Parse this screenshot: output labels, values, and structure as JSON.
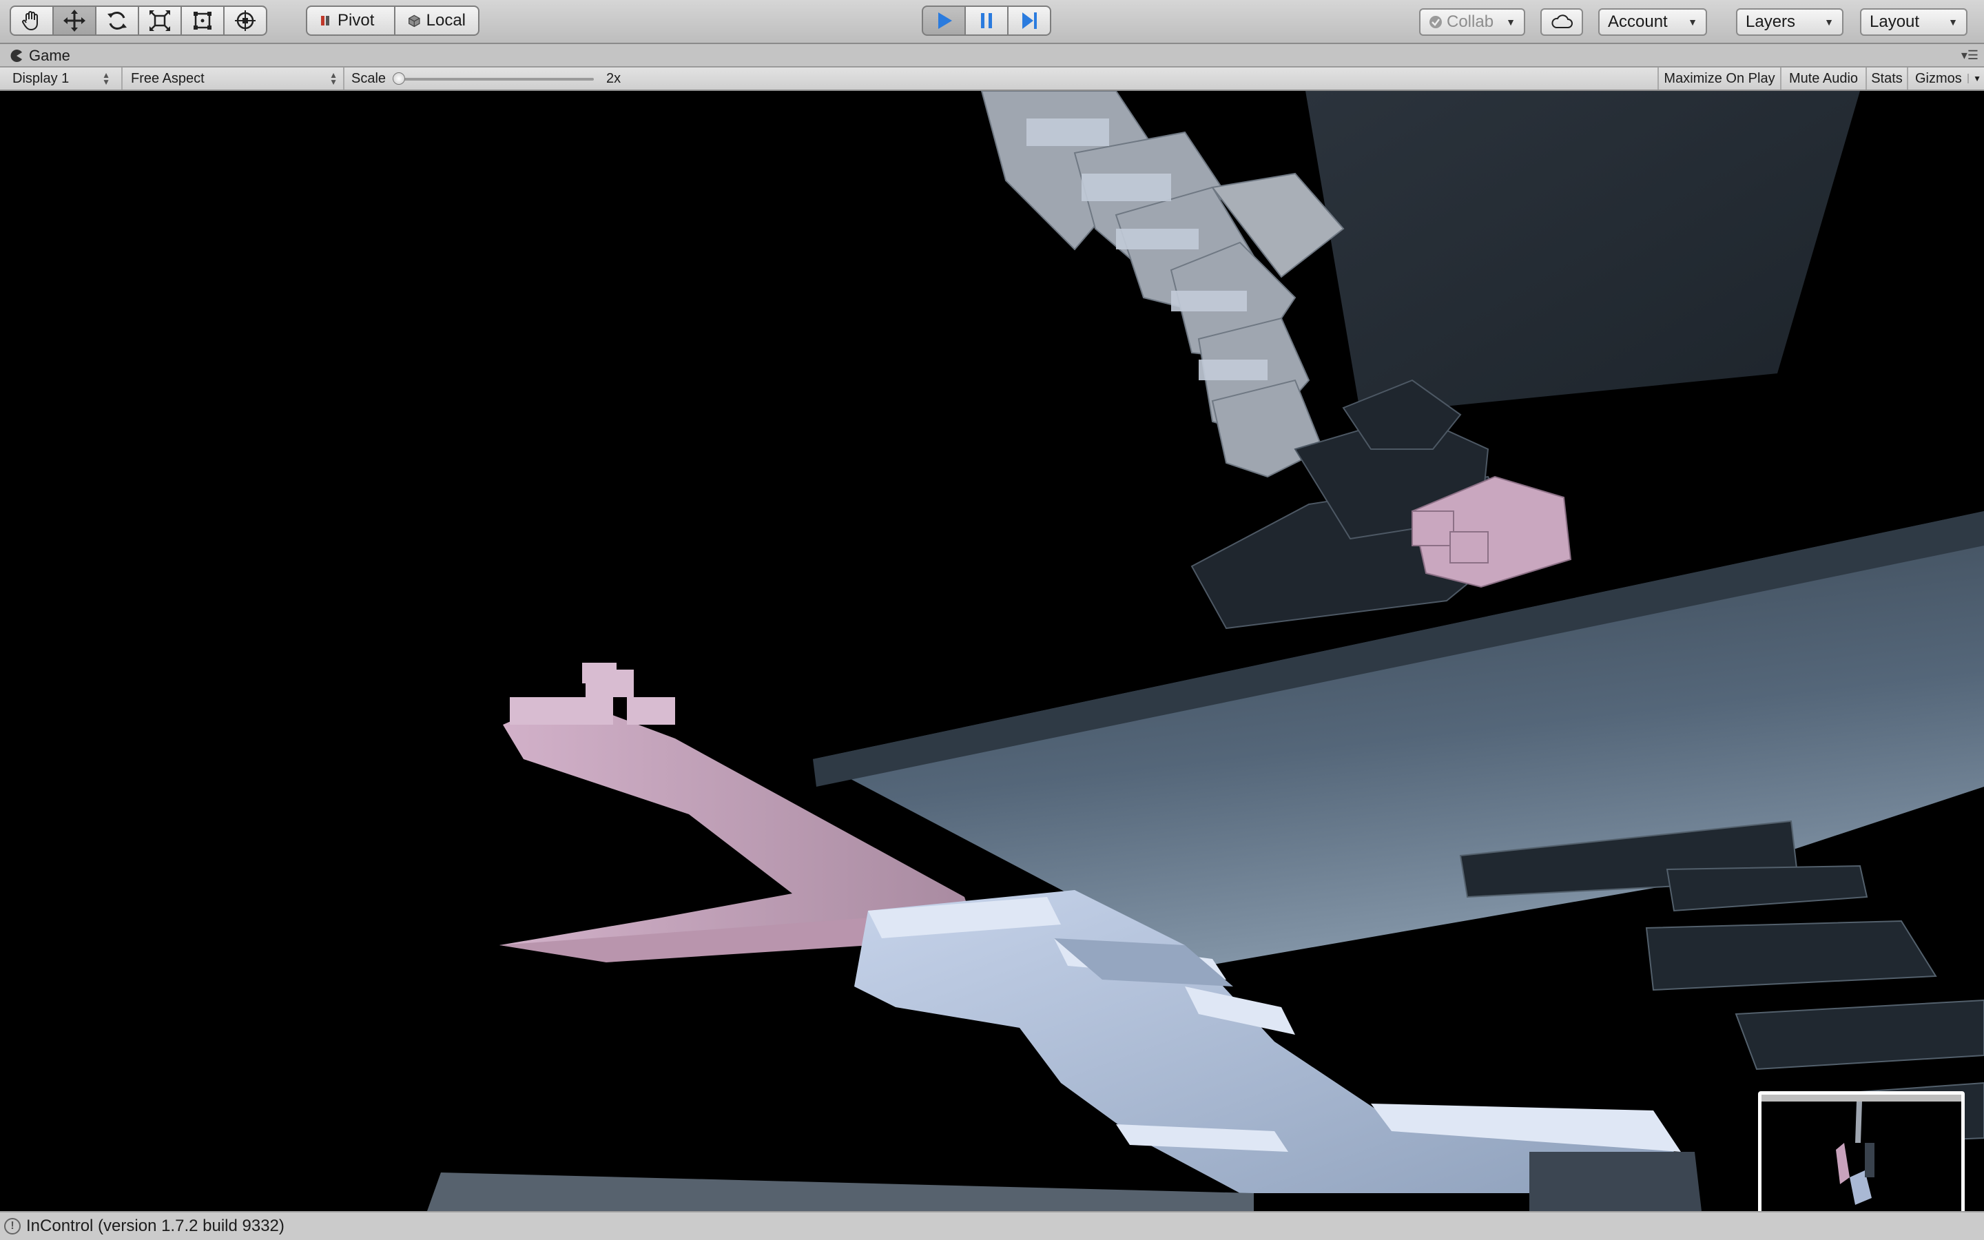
{
  "toolbar": {
    "tools": [
      {
        "icon": "hand-icon",
        "active": false
      },
      {
        "icon": "move-icon",
        "active": true
      },
      {
        "icon": "rotate-icon",
        "active": false
      },
      {
        "icon": "scale-icon",
        "active": false
      },
      {
        "icon": "rect-transform-icon",
        "active": false
      },
      {
        "icon": "transform-all-icon",
        "active": false
      }
    ],
    "pivot_label": "Pivot",
    "local_label": "Local",
    "play_state": "playing",
    "collab_label": "Collab",
    "account_label": "Account",
    "layers_label": "Layers",
    "layout_label": "Layout"
  },
  "game_window": {
    "tab_title": "Game",
    "display_label": "Display 1",
    "aspect_label": "Free Aspect",
    "scale_label": "Scale",
    "scale_value": "2x",
    "scale_fraction": 0.0,
    "buttons": {
      "maximize": "Maximize On Play",
      "mute": "Mute Audio",
      "stats": "Stats",
      "gizmos": "Gizmos"
    }
  },
  "status": {
    "message": "InControl (version 1.7.2 build 9332)"
  },
  "colors": {
    "play_blue": "#2a7bde",
    "pink_block": "#c8a2bc",
    "blue_block": "#a9b8d4",
    "dark_block": "#27303a"
  }
}
